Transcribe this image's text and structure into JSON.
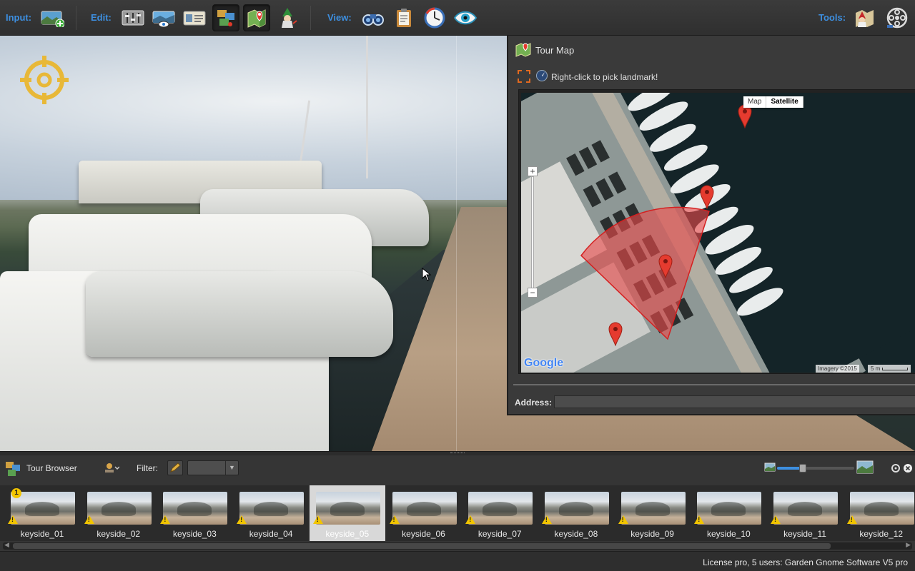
{
  "toolbar": {
    "input_label": "Input:",
    "edit_label": "Edit:",
    "view_label": "View:",
    "tools_label": "Tools:"
  },
  "map": {
    "title": "Tour Map",
    "hint": "Right-click to pick landmark!",
    "map_type_map": "Map",
    "map_type_satellite": "Satellite",
    "selected_map_type": "Satellite",
    "zoom_in": "+",
    "zoom_out": "−",
    "google_logo": "Google",
    "imagery": "Imagery ©2015",
    "scale": "5 m",
    "address_label": "Address:",
    "address_value": ""
  },
  "tour_browser": {
    "title": "Tour Browser",
    "filter_label": "Filter:",
    "filter_value": "",
    "thumbnail_zoom_fraction": 0.33,
    "first_marker_badge": "1",
    "thumbnails": [
      {
        "label": "keyside_01",
        "warning": true,
        "selected": false
      },
      {
        "label": "keyside_02",
        "warning": true,
        "selected": false
      },
      {
        "label": "keyside_03",
        "warning": true,
        "selected": false
      },
      {
        "label": "keyside_04",
        "warning": true,
        "selected": false
      },
      {
        "label": "keyside_05",
        "warning": true,
        "selected": true
      },
      {
        "label": "keyside_06",
        "warning": true,
        "selected": false
      },
      {
        "label": "keyside_07",
        "warning": true,
        "selected": false
      },
      {
        "label": "keyside_08",
        "warning": true,
        "selected": false
      },
      {
        "label": "keyside_09",
        "warning": true,
        "selected": false
      },
      {
        "label": "keyside_10",
        "warning": true,
        "selected": false
      },
      {
        "label": "keyside_11",
        "warning": true,
        "selected": false
      },
      {
        "label": "keyside_12",
        "warning": true,
        "selected": false
      }
    ]
  },
  "status": {
    "license": "License pro, 5 users: Garden Gnome Software V5 pro"
  },
  "colors": {
    "accent": "#3d8fe0",
    "viewcone": "#e84a4a",
    "warning": "#f2c500",
    "pin": "#e53b2f"
  }
}
